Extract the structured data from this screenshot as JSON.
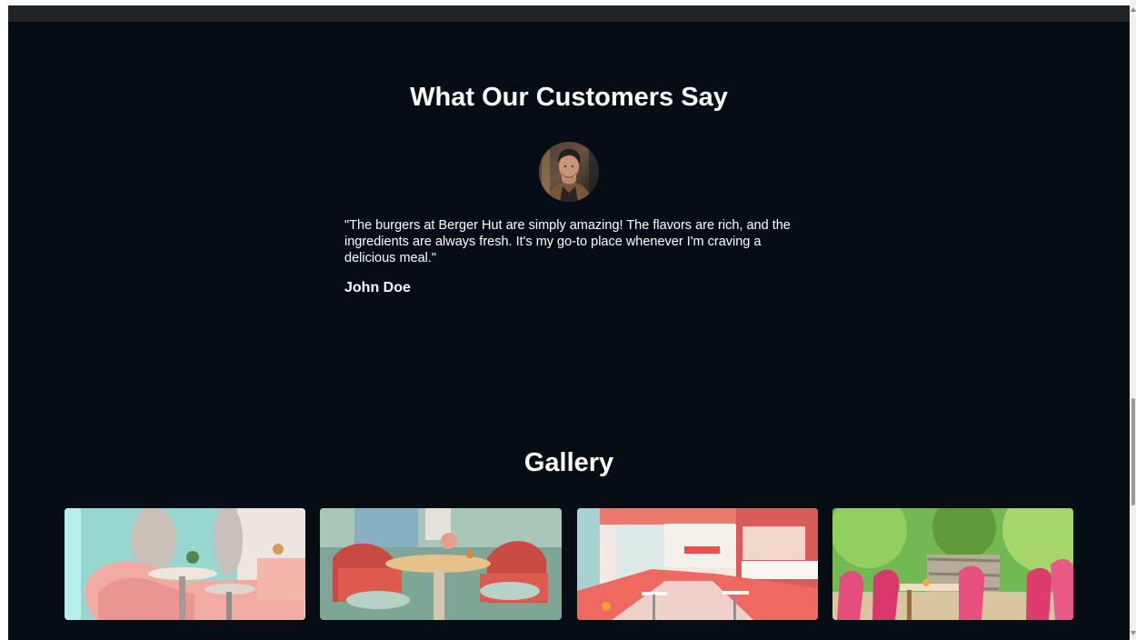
{
  "testimonials": {
    "title": "What Our Customers Say",
    "quote": "\"The burgers at Berger Hut are simply amazing! The flavors are rich, and the ingredients are always fresh. It's my go-to place whenever I'm craving a delicious meal.\"",
    "author": "John Doe",
    "avatar_icon": "customer-avatar"
  },
  "gallery": {
    "title": "Gallery",
    "images": [
      {
        "icon": "pink-mint-booth-interior-image"
      },
      {
        "icon": "red-booth-table-interior-image"
      },
      {
        "icon": "red-diner-counter-interior-image"
      },
      {
        "icon": "garden-patio-seating-image"
      }
    ]
  },
  "colors": {
    "background": "#060d14",
    "top_strip": "#202224",
    "text": "#ffffff"
  }
}
